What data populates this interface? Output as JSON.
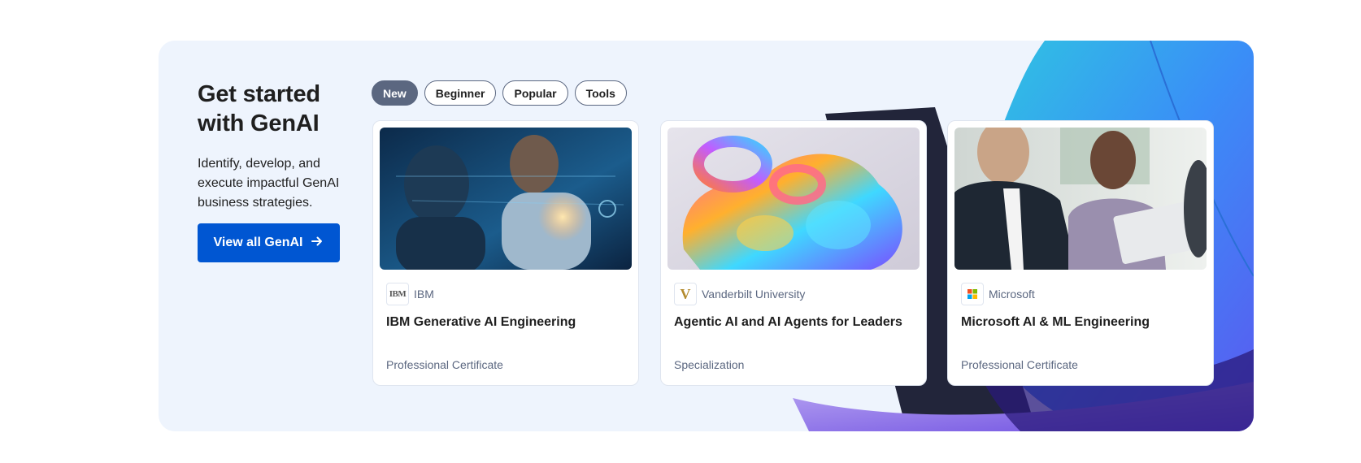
{
  "section": {
    "title": "Get started with GenAI",
    "description": "Identify, develop, and execute impactful GenAI business strategies.",
    "cta_label": "View all GenAI"
  },
  "filters": [
    {
      "label": "New",
      "active": true
    },
    {
      "label": "Beginner",
      "active": false
    },
    {
      "label": "Popular",
      "active": false
    },
    {
      "label": "Tools",
      "active": false
    }
  ],
  "cards": [
    {
      "partner": "IBM",
      "title": "IBM Generative AI Engineering",
      "type": "Professional Certificate"
    },
    {
      "partner": "Vanderbilt University",
      "title": "Agentic AI and AI Agents for Leaders",
      "type": "Specialization"
    },
    {
      "partner": "Microsoft",
      "title": "Microsoft AI & ML Engineering",
      "type": "Professional Certificate"
    }
  ],
  "logos": {
    "ibm": "IBM",
    "vanderbilt": "V"
  },
  "colors": {
    "accent": "#0056d2",
    "panel_bg": "#eef4fd",
    "chip_active": "#5b6780"
  }
}
